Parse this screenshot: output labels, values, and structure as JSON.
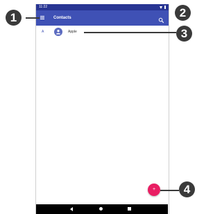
{
  "status_bar": {
    "time": "11:22"
  },
  "app_bar": {
    "title": "Contacts",
    "menu_icon": "menu-icon",
    "search_icon": "search-icon"
  },
  "contacts": [
    {
      "index_letter": "A",
      "name": "Apple"
    }
  ],
  "fab": {
    "label": "+"
  },
  "callouts": [
    "1",
    "2",
    "3",
    "4"
  ],
  "colors": {
    "status_bar": "#283593",
    "app_bar": "#3f51b5",
    "fab": "#e91e63",
    "callout": "#3a3a3a"
  }
}
